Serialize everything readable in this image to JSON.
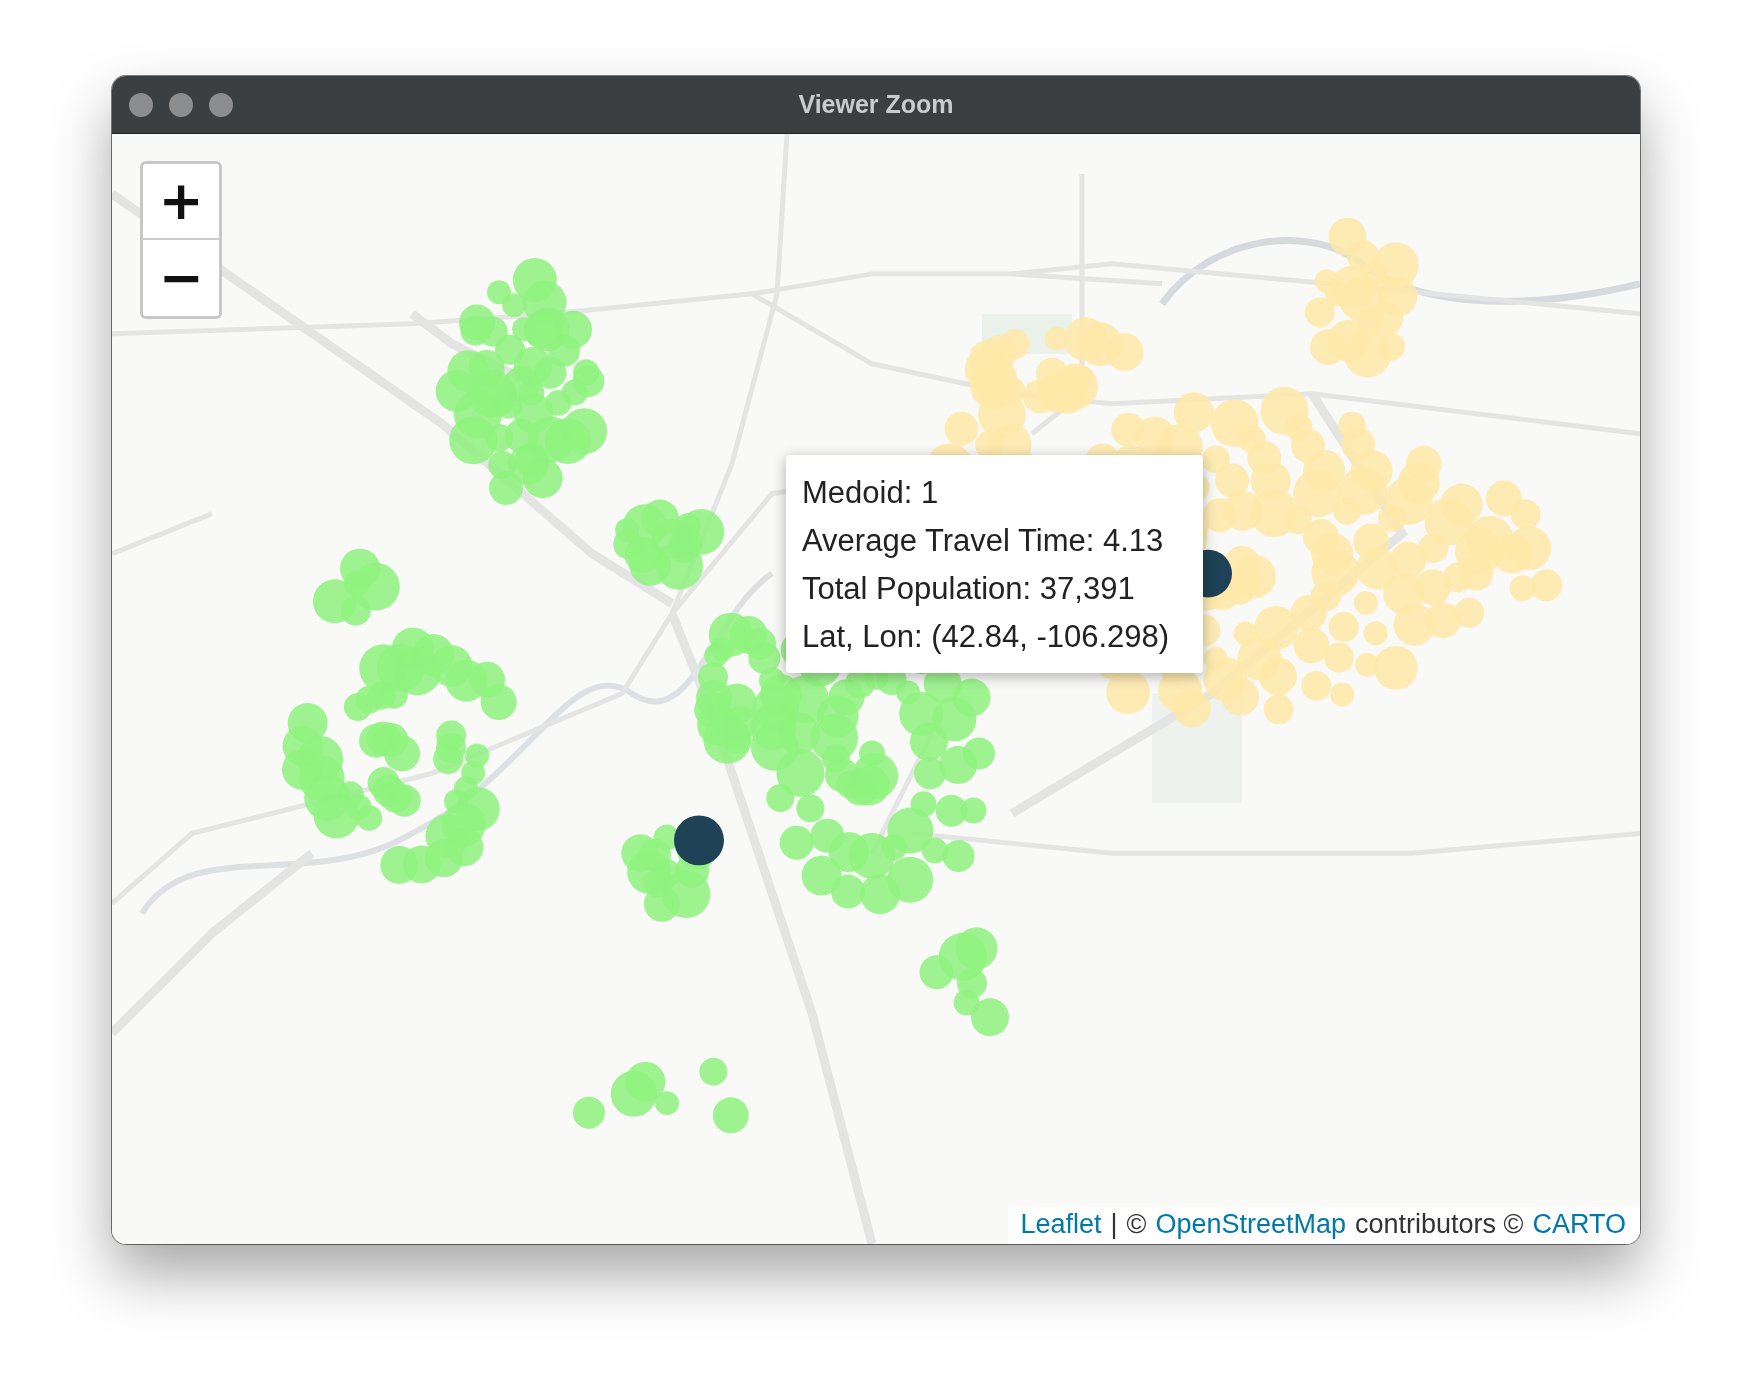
{
  "window": {
    "title": "Viewer Zoom"
  },
  "zoom_controls": [
    {
      "label": "+"
    },
    {
      "label": "−"
    }
  ],
  "clusters": [
    {
      "color": "#8ef27e"
    },
    {
      "color": "#ffe9a8"
    }
  ],
  "tooltip": {
    "lines": [
      "Medoid: 1",
      "Average Travel Time: 4.13",
      "Total Population: 37,391",
      "Lat, Lon: (42.84, -106.298)"
    ]
  },
  "attribution": [
    {
      "text": "Leaflet",
      "link": true
    },
    {
      "text": "|",
      "link": false
    },
    {
      "text": "©",
      "link": false
    },
    {
      "text": "OpenStreetMap",
      "link": true
    },
    {
      "text": "contributors ©",
      "link": false
    },
    {
      "text": "CARTO",
      "link": true
    }
  ]
}
